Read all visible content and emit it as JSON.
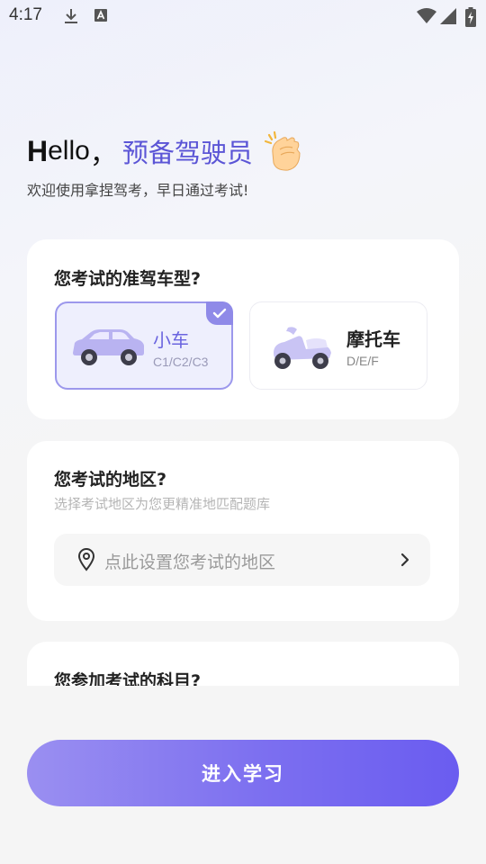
{
  "status_bar": {
    "time": "4:17",
    "left_icons": [
      "download-icon",
      "a-icon"
    ],
    "right_icons": [
      "wifi-icon",
      "signal-icon",
      "battery-icon"
    ]
  },
  "greeting": {
    "hello_h": "H",
    "hello_rest": "ello",
    "comma": "，",
    "name": "预备驾驶员",
    "emoji": "clapping-hands-icon",
    "subtitle": "欢迎使用拿捏驾考，早日通过考试!"
  },
  "vehicle_section": {
    "title": "您考试的准驾车型?",
    "options": [
      {
        "name": "小车",
        "license": "C1/C2/C3",
        "icon": "car-icon",
        "selected": true
      },
      {
        "name": "摩托车",
        "license": "D/E/F",
        "icon": "motorcycle-icon",
        "selected": false
      }
    ]
  },
  "region_section": {
    "title": "您考试的地区?",
    "hint": "选择考试地区为您更精准地匹配题库",
    "placeholder": "点此设置您考试的地区"
  },
  "subject_section": {
    "title": "您参加考试的科目?"
  },
  "enter_button": {
    "label": "进入学习"
  },
  "colors": {
    "accent": "#6a64df",
    "button_start": "#9a8ff1",
    "button_end": "#6a5cf0",
    "selected_border": "#9c98ec"
  }
}
